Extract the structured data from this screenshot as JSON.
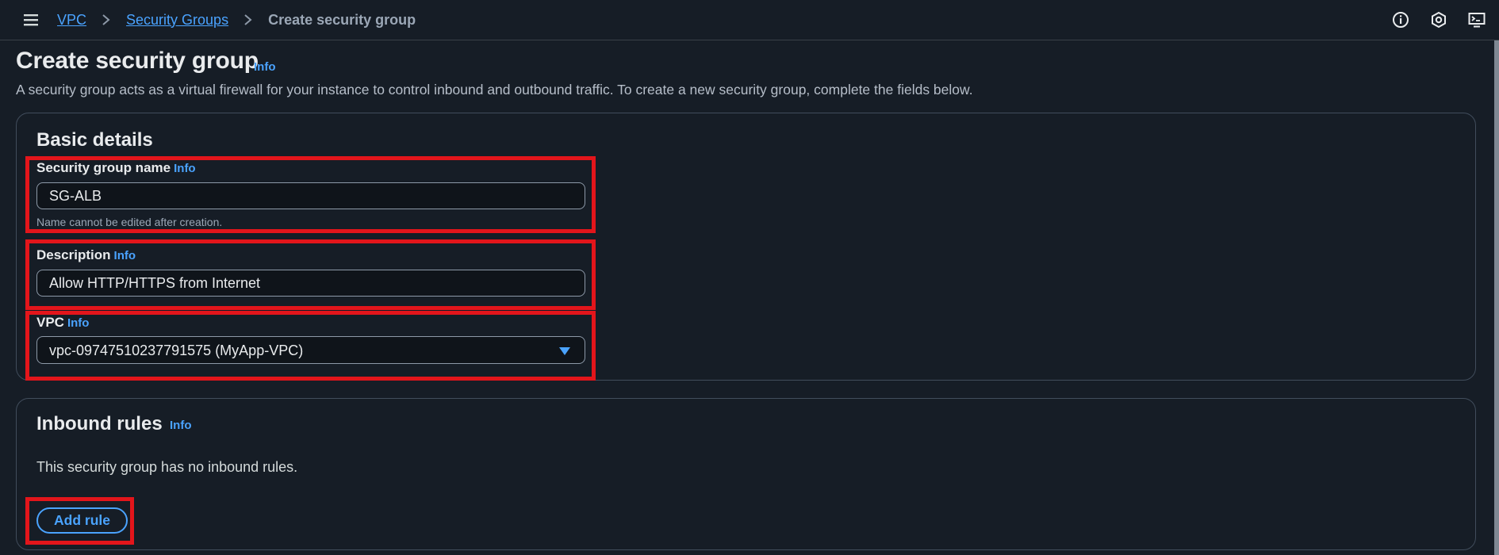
{
  "breadcrumb": {
    "items": [
      {
        "label": "VPC"
      },
      {
        "label": "Security Groups"
      }
    ],
    "current": "Create security group"
  },
  "header": {
    "title": "Create security group",
    "info_label": "Info",
    "description": "A security group acts as a virtual firewall for your instance to control inbound and outbound traffic. To create a new security group, complete the fields below."
  },
  "basic_details": {
    "title": "Basic details",
    "name_field": {
      "label": "Security group name",
      "info_label": "Info",
      "value": "SG-ALB",
      "hint": "Name cannot be edited after creation."
    },
    "description_field": {
      "label": "Description",
      "info_label": "Info",
      "value": "Allow HTTP/HTTPS from Internet"
    },
    "vpc_field": {
      "label": "VPC",
      "info_label": "Info",
      "value": "vpc-09747510237791575 (MyApp-VPC)"
    }
  },
  "inbound_rules": {
    "title": "Inbound rules",
    "info_label": "Info",
    "empty_text": "This security group has no inbound rules.",
    "add_rule_label": "Add rule"
  },
  "icons": {
    "menu": "hamburger-menu-icon",
    "separator": "chevron-right-icon",
    "info": "info-circle-icon",
    "settings": "settings-hexagon-icon",
    "cloudshell": "cloudshell-terminal-icon",
    "dropdown": "caret-down-icon"
  },
  "colors": {
    "background": "#161d26",
    "link": "#4aa3ff",
    "highlight": "#e3151b",
    "panel_border": "#414d5c"
  }
}
